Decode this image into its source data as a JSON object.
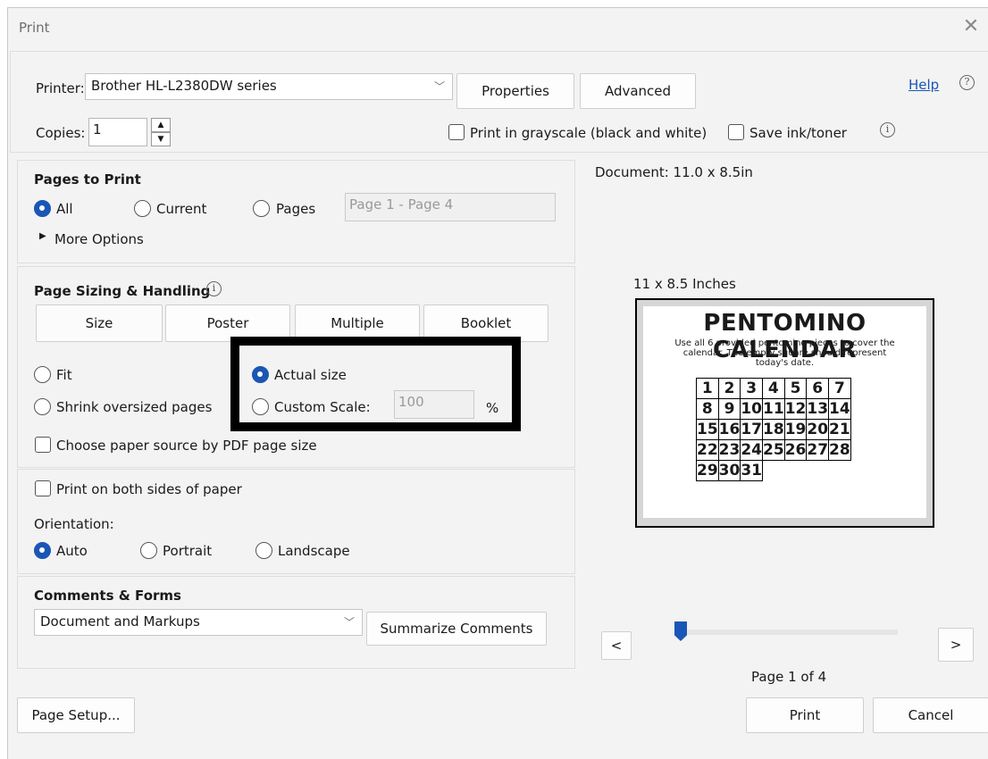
{
  "dialog": {
    "title": "Print",
    "close_glyph": "✕"
  },
  "top": {
    "printer_label": "Printer:",
    "printer_value": "Brother HL-L2380DW series",
    "properties_label": "Properties",
    "advanced_label": "Advanced",
    "help_label": "Help",
    "help_glyph": "?",
    "copies_label": "Copies:",
    "copies_value": "1",
    "spin_up": "▲",
    "spin_down": "▼",
    "grayscale_label": "Print in grayscale (black and white)",
    "save_ink_label": "Save ink/toner",
    "info_glyph": "i"
  },
  "pages_to_print": {
    "title": "Pages to Print",
    "all_label": "All",
    "current_label": "Current",
    "pages_label": "Pages",
    "pages_placeholder": "Page 1 - Page 4",
    "more_options_label": "More Options",
    "more_arrow": "▶"
  },
  "sizing": {
    "title": "Page Sizing & Handling",
    "info_glyph": "i",
    "tabs": [
      "Size",
      "Poster",
      "Multiple",
      "Booklet"
    ],
    "fit_label": "Fit",
    "actual_size_label": "Actual size",
    "shrink_label": "Shrink oversized pages",
    "custom_scale_label": "Custom Scale:",
    "custom_scale_value": "100",
    "percent": "%",
    "paper_source_label": "Choose paper source by PDF page size"
  },
  "orientation": {
    "both_sides_label": "Print on both sides of paper",
    "title": "Orientation:",
    "auto_label": "Auto",
    "portrait_label": "Portrait",
    "landscape_label": "Landscape"
  },
  "comments": {
    "title": "Comments & Forms",
    "value": "Document and Markups",
    "summarize_label": "Summarize Comments"
  },
  "preview": {
    "document_size": "Document: 11.0 x 8.5in",
    "paper_size": "11 x 8.5 Inches",
    "calendar_title": "PENTOMINO CALENDAR",
    "calendar_subtitle_1": "Use all 6 provided pentomino pieces to cover the",
    "calendar_subtitle_2": "calendar. The empty square should represent",
    "calendar_subtitle_3": "today's date.",
    "calendar_rows": [
      [
        "1",
        "2",
        "3",
        "4",
        "5",
        "6",
        "7"
      ],
      [
        "8",
        "9",
        "10",
        "11",
        "12",
        "13",
        "14"
      ],
      [
        "15",
        "16",
        "17",
        "18",
        "19",
        "20",
        "21"
      ],
      [
        "22",
        "23",
        "24",
        "25",
        "26",
        "27",
        "28"
      ],
      [
        "29",
        "30",
        "31"
      ]
    ],
    "prev_label": "<",
    "next_label": ">",
    "page_indicator": "Page 1 of 4",
    "page_position": 0.0
  },
  "footer": {
    "page_setup_label": "Page Setup...",
    "print_label": "Print",
    "cancel_label": "Cancel"
  },
  "colors": {
    "accent": "#1a56b5",
    "highlight_box": "#000000"
  }
}
